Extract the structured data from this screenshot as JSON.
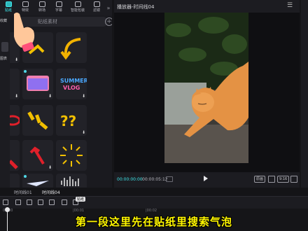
{
  "toolbar": {
    "items": [
      {
        "label": "贴纸",
        "active": true
      },
      {
        "label": "特效",
        "active": false
      },
      {
        "label": "转场",
        "active": false
      },
      {
        "label": "字幕",
        "active": false
      },
      {
        "label": "智能包装",
        "active": false
      },
      {
        "label": "滤镜",
        "active": false
      }
    ],
    "expand": "»"
  },
  "leftnav": {
    "items": [
      "收藏",
      "图表"
    ]
  },
  "search": {
    "text": "贴纸素材"
  },
  "player": {
    "title": "播放器-时间线04",
    "time_current": "00:00:00:00",
    "time_total": "00:00:05:12",
    "btn_original": "原画",
    "btn_ratio": "9:16"
  },
  "timeline": {
    "tabs": [
      "时间线01",
      "时间线04"
    ],
    "ruler": [
      "00:00",
      "|00:01",
      "|00:02"
    ],
    "badge": "贴纸"
  },
  "subtitle": "第一段这里先在贴纸里搜索气泡",
  "colors": {
    "accent": "#3ee6ea",
    "subtitle": "#fff600"
  }
}
